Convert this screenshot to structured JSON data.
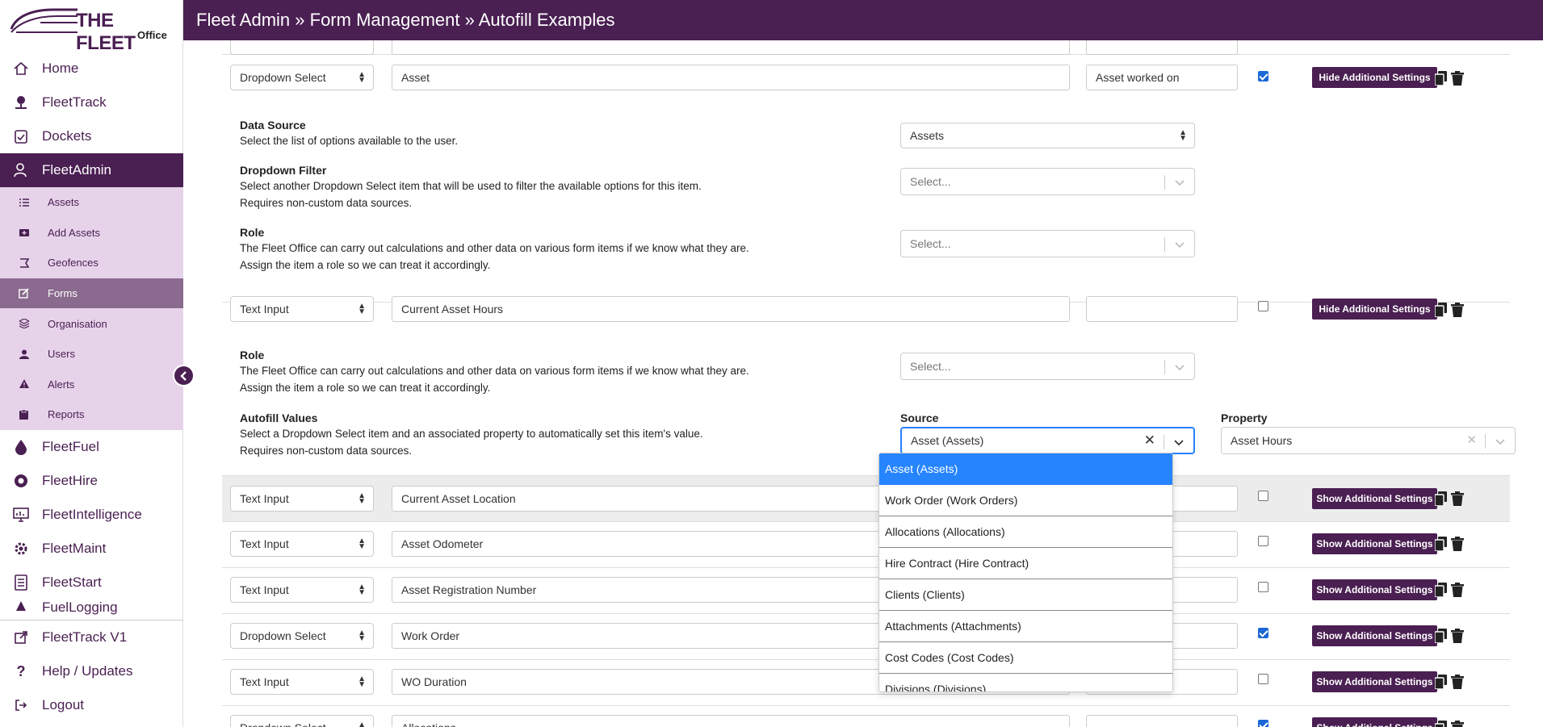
{
  "logo": {
    "brand": "THE FLEET",
    "sub": "Office"
  },
  "breadcrumb": "Fleet Admin » Form Management » Autofill Examples",
  "nav": {
    "items": [
      {
        "label": "Home",
        "icon": "home-icon"
      },
      {
        "label": "FleetTrack",
        "icon": "map-pin-icon"
      },
      {
        "label": "Dockets",
        "icon": "clipboard-check-icon"
      },
      {
        "label": "FleetAdmin",
        "icon": "user-gear-icon"
      }
    ],
    "sub": [
      {
        "label": "Assets",
        "icon": "list-icon"
      },
      {
        "label": "Add Assets",
        "icon": "folder-plus-icon"
      },
      {
        "label": "Geofences",
        "icon": "geofence-icon"
      },
      {
        "label": "Forms",
        "icon": "edit-icon"
      },
      {
        "label": "Organisation",
        "icon": "layers-icon"
      },
      {
        "label": "Users",
        "icon": "user-icon"
      },
      {
        "label": "Alerts",
        "icon": "warning-icon"
      },
      {
        "label": "Reports",
        "icon": "report-icon"
      }
    ],
    "more": [
      {
        "label": "FleetFuel",
        "icon": "fuel-drop-icon"
      },
      {
        "label": "FleetHire",
        "icon": "hire-icon"
      },
      {
        "label": "FleetIntelligence",
        "icon": "monitor-icon"
      },
      {
        "label": "FleetMaint",
        "icon": "maintenance-gear-icon"
      },
      {
        "label": "FleetStart",
        "icon": "checklist-icon"
      },
      {
        "label": "FuelLogging",
        "icon": "fuel-icon"
      }
    ],
    "bottom": [
      {
        "label": "FleetTrack V1",
        "icon": "external-link-icon"
      },
      {
        "label": "Help / Updates",
        "icon": "question-icon"
      },
      {
        "label": "Logout",
        "icon": "logout-icon"
      }
    ]
  },
  "rows": {
    "asset": {
      "type": "Dropdown Select",
      "name": "Asset",
      "desc": "Asset worked on",
      "checked": true,
      "button": "Hide Additional Settings"
    },
    "hours": {
      "type": "Text Input",
      "name": "Current Asset Hours",
      "desc": "",
      "checked": false,
      "button": "Hide Additional Settings"
    },
    "location": {
      "type": "Text Input",
      "name": "Current Asset Location",
      "checked": false,
      "button": "Show Additional Settings"
    },
    "odometer": {
      "type": "Text Input",
      "name": "Asset Odometer",
      "checked": false,
      "button": "Show Additional Settings"
    },
    "rego": {
      "type": "Text Input",
      "name": "Asset Registration Number",
      "checked": false,
      "button": "Show Additional Settings"
    },
    "workorder": {
      "type": "Dropdown Select",
      "name": "Work Order",
      "checked": true,
      "button": "Show Additional Settings"
    },
    "duration": {
      "type": "Text Input",
      "name": "WO Duration",
      "checked": false,
      "button": "Show Additional Settings"
    },
    "allocations": {
      "type": "Dropdown Select",
      "name": "Allocations",
      "checked": true,
      "button": "Show Additional Settings"
    }
  },
  "settings": {
    "data_source": {
      "title": "Data Source",
      "desc": "Select the list of options available to the user.",
      "value": "Assets"
    },
    "dropdown_filter": {
      "title": "Dropdown Filter",
      "line1": "Select another Dropdown Select item that will be used to filter the available options for this item.",
      "line2": "Requires non-custom data sources.",
      "placeholder": "Select..."
    },
    "role": {
      "title": "Role",
      "line1": "The Fleet Office can carry out calculations and other data on various form items if we know what they are.",
      "line2": "Assign the item a role so we can treat it accordingly.",
      "placeholder": "Select..."
    },
    "autofill": {
      "title": "Autofill Values",
      "line1": "Select a Dropdown Select item and an associated property to automatically set this item's value.",
      "line2": "Requires non-custom data sources.",
      "source_label": "Source",
      "property_label": "Property",
      "source_value": "Asset (Assets)",
      "property_value": "Asset Hours"
    }
  },
  "dropdown_options": [
    "Asset (Assets)",
    "Work Order (Work Orders)",
    "Allocations (Allocations)",
    "Hire Contract (Hire Contract)",
    "Clients (Clients)",
    "Attachments (Attachments)",
    "Cost Codes (Cost Codes)",
    "Divisions (Divisions)"
  ],
  "colors": {
    "brand": "#4a1f52",
    "submenu": "#e6d3ea",
    "highlight": "#2684ff"
  }
}
